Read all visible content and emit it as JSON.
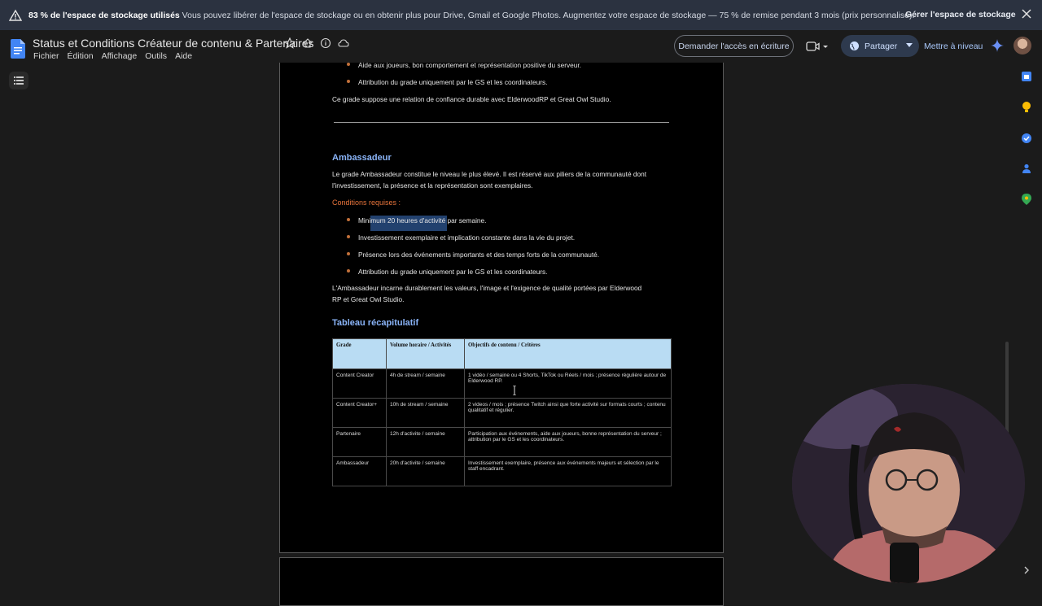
{
  "banner": {
    "bold": "83 % de l'espace de stockage utilisés",
    "message": " Vous pouvez libérer de l'espace de stockage ou en obtenir plus pour Drive, Gmail et Google Photos. Augmentez votre espace de stockage — 75 % de remise pendant 3 mois (prix personnalisé).",
    "manage": "Gérer l'espace de stockage"
  },
  "header": {
    "title": "Status et Conditions Créateur de contenu & Partenaires",
    "menu": [
      "Fichier",
      "Édition",
      "Affichage",
      "Outils",
      "Aide"
    ],
    "request_access": "Demander l'accès en écriture",
    "share": "Partager",
    "upgrade": "Mettre à niveau"
  },
  "doc": {
    "prev_bullets": [
      "Aide aux joueurs, bon comportement et représentation positive du serveur.",
      "Attribution du grade uniquement par le GS et les coordinateurs."
    ],
    "prev_note": "Ce grade suppose une relation de confiance durable avec ElderwoodRP et Great Owl Studio.",
    "amb_title": "Ambassadeur",
    "amb_p1": "Le grade Ambassadeur constitue le niveau le plus élevé. Il est réservé aux piliers de la communauté dont",
    "amb_p2": "l'investissement, la présence et la représentation sont exemplaires.",
    "cond_title": "Conditions requises :",
    "amb_bullets": [
      "Minimum 20 heures d'activité par semaine.",
      "Investissement exemplaire et implication constante dans la vie du projet.",
      "Présence lors des événements importants et des temps forts de la communauté.",
      "Attribution du grade uniquement par le GS et les coordinateurs."
    ],
    "amb_close1": "L'Ambassadeur incarne durablement les valeurs, l'image et l'exigence de qualité portées par Elderwood",
    "amb_close2": "RP et Great Owl Studio.",
    "table_title": "Tableau récapitulatif",
    "table": {
      "headers": [
        "Grade",
        "Volume horaire / Activités",
        "Objectifs de contenu / Critères"
      ],
      "rows": [
        [
          "Content Creator",
          "4h de stream / semaine",
          "1 vidéo / semaine ou 4 Shorts, TikTok ou Réels / mois ; présence régulière autour de Elderwood RP."
        ],
        [
          "Content Creator+",
          "10h de stream / semaine",
          "2 videos / mois ; présence  Twitch ainsi que  forte activité sur formats courts ; contenu qualitatif et régulier."
        ],
        [
          "Partenaire",
          "12h d'activite / semaine",
          "Participation aux événements, aide aux joueurs, bonne représentation du serveur ; attribution par le GS et les coordinateurs."
        ],
        [
          "Ambassadeur",
          "20h d'activite / semaine",
          "Investissement exemplaire, présence aux événements majeurs et sélection par le staff encadrant."
        ]
      ]
    }
  },
  "colors": {
    "banner_bg": "#2b3240",
    "accent_blue": "#8ab4f8",
    "conditions_orange": "#e8743b",
    "table_header_bg": "#b9dcf3"
  },
  "icons": [
    "warning-icon",
    "close-icon",
    "docs-logo-icon",
    "star-icon",
    "move-icon",
    "info-icon",
    "cloud-icon",
    "meet-icon",
    "globe-icon",
    "gemini-icon",
    "outline-icon",
    "calendar-icon",
    "keep-icon",
    "tasks-icon",
    "contacts-icon",
    "maps-icon"
  ]
}
